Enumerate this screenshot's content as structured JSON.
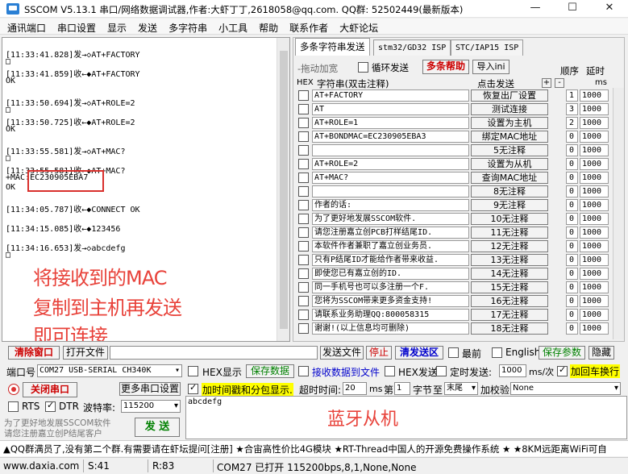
{
  "window": {
    "title": "SSCOM V5.13.1 串口/网络数据调试器,作者:大虾丁丁,2618058@qq.com. QQ群: 52502449(最新版本)",
    "minimize": "—",
    "maximize": "☐",
    "close": "✕"
  },
  "menu": [
    "通讯端口",
    "串口设置",
    "显示",
    "发送",
    "多字符串",
    "小工具",
    "帮助",
    "联系作者",
    "大虾论坛"
  ],
  "receive": {
    "lines": [
      "[11:33:41.828]发→◇AT+FACTORY",
      "□",
      "[11:33:41.859]收←◆AT+FACTORY",
      "OK",
      "",
      "[11:33:50.694]发→◇AT+ROLE=2",
      "□",
      "[11:33:50.725]收←◆AT+ROLE=2",
      "OK",
      "",
      "[11:33:55.581]发→◇AT+MAC?",
      "□",
      "[11:33:55.581]收←◆AT+MAC?",
      "+MAC:EC230905EBA7",
      "OK",
      "",
      "[11:34:05.787]收←◆CONNECT OK",
      "",
      "[11:34:15.085]收←◆123456",
      "",
      "[11:34:16.653]发→◇abcdefg",
      "□"
    ],
    "annotation_lines": [
      "将接收到的MAC",
      "复制到主机再发送",
      "即可连接"
    ]
  },
  "tabs": [
    "多条字符串发送",
    "stm32/GD32 ISP",
    "STC/IAP15 ISP"
  ],
  "multistring": {
    "drag_hint": "-拖动加宽",
    "loop_label": "循环发送",
    "help_button": "多条帮助",
    "import_button": "导入ini",
    "order_label": "顺序",
    "delay_label": "延时",
    "hex_label": "HEX",
    "string_header": "字符串(双击注释)",
    "click_send_header": "点击发送",
    "plus": "+",
    "minus": "-",
    "ms_unit": "ms",
    "rows": [
      {
        "text": "AT+FACTORY",
        "button": "恢复出厂设置",
        "order": "1",
        "delay": "1000"
      },
      {
        "text": "AT",
        "button": "测试连接",
        "order": "3",
        "delay": "1000"
      },
      {
        "text": "AT+ROLE=1",
        "button": "设置为主机",
        "order": "2",
        "delay": "1000"
      },
      {
        "text": "AT+BONDMAC=EC230905EBA3",
        "button": "绑定MAC地址",
        "order": "0",
        "delay": "1000"
      },
      {
        "text": "",
        "button": "5无注释",
        "order": "0",
        "delay": "1000"
      },
      {
        "text": "AT+ROLE=2",
        "button": "设置为从机",
        "order": "0",
        "delay": "1000"
      },
      {
        "text": "AT+MAC?",
        "button": "查询MAC地址",
        "order": "0",
        "delay": "1000"
      },
      {
        "text": "",
        "button": "8无注释",
        "order": "0",
        "delay": "1000"
      },
      {
        "text": "作者的话:",
        "button": "9无注释",
        "order": "0",
        "delay": "1000"
      },
      {
        "text": "为了更好地发展SSCOM软件.",
        "button": "10无注释",
        "order": "0",
        "delay": "1000"
      },
      {
        "text": "请您注册嘉立创PCB打样结尾ID.",
        "button": "11无注释",
        "order": "0",
        "delay": "1000"
      },
      {
        "text": "本软件作者兼职了嘉立创业务员.",
        "button": "12无注释",
        "order": "0",
        "delay": "1000"
      },
      {
        "text": "只有P结尾ID才能给作者带来收益.",
        "button": "13无注释",
        "order": "0",
        "delay": "1000"
      },
      {
        "text": "即使您已有嘉立创的ID.",
        "button": "14无注释",
        "order": "0",
        "delay": "1000"
      },
      {
        "text": "同一手机号也可以多注册一个F.",
        "button": "15无注释",
        "order": "0",
        "delay": "1000"
      },
      {
        "text": "您将为SSCOM带来更多资金支持!",
        "button": "16无注释",
        "order": "0",
        "delay": "1000"
      },
      {
        "text": "请联系业务助理QQ:800058315",
        "button": "17无注释",
        "order": "0",
        "delay": "1000"
      },
      {
        "text": "谢谢!(以上信息均可删除)",
        "button": "18无注释",
        "order": "0",
        "delay": "1000"
      }
    ]
  },
  "toolbar": {
    "clear_window": "清除窗口",
    "open_file": "打开文件",
    "send_file": "发送文件",
    "stop": "停止",
    "clear_send": "清发送区",
    "top": "最前",
    "english": "English",
    "save_params": "保存参数",
    "hide": "隐藏"
  },
  "controls": {
    "port_label": "端口号",
    "port_value": "COM27 USB-SERIAL CH340K",
    "hex_display": "HEX显示",
    "save_data": "保存数据",
    "recv_to_file": "接收数据到文件",
    "hex_send": "HEX发送",
    "timed_send": "定时发送:",
    "timed_value": "1000",
    "ms_per": "ms/次",
    "add_newline": "加回车换行",
    "close_port": "关闭串口",
    "more_settings": "更多串口设置",
    "timestamp_label": "加时间戳和分包显示.",
    "timeout_label": "超时时间:",
    "timeout_value": "20",
    "ms": "ms",
    "nth_label": "第",
    "nth_value": "1",
    "byte_label": "字节",
    "to_label": "至",
    "end_value": "末尾",
    "checksum_label": "加校验",
    "checksum_value": "None",
    "rts": "RTS",
    "dtr": "DTR",
    "baud_label": "波特率:",
    "baud_value": "115200",
    "send_text": "abcdefg",
    "send_button": "发 送",
    "promo_line1": "为了更好地发展SSCOM软件",
    "promo_line2": "请您注册嘉立创P结尾客户",
    "annotation": "蓝牙从机"
  },
  "ticker": "▲QQ群满员了,没有第二个群.有需要请在虾坛提问[注册] ★合宙高性价比4G模块 ★RT-Thread中国人的开源免费操作系统 ★ ★8KM远距离WiFi可自",
  "status": {
    "url": "www.daxia.com",
    "sent": "S:41",
    "received": "R:83",
    "port_status": "COM27 已打开  115200bps,8,1,None,None"
  },
  "colors": {
    "annotation_red": "#e8423a",
    "highlight_yellow": "#ffff00",
    "label_red": "#cc0000",
    "label_green": "#008000",
    "label_blue": "#0000cc"
  }
}
